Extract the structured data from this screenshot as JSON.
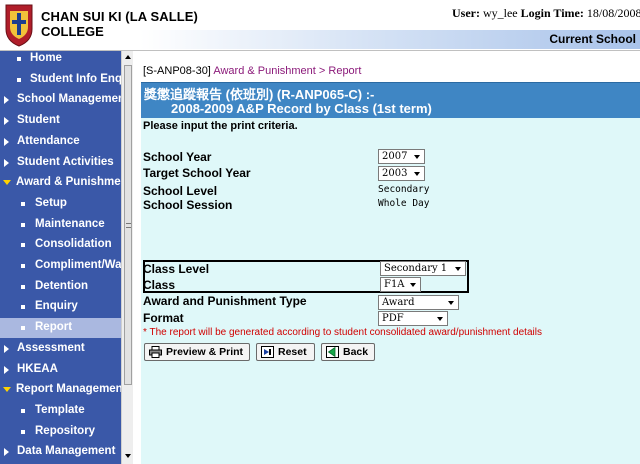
{
  "header": {
    "school_line1": "CHAN SUI KI (LA SALLE)",
    "school_line2": "COLLEGE",
    "user_label": "User:",
    "user_value": "wy_lee",
    "login_time_label": "Login Time:",
    "login_time_value": "18/08/2008",
    "current_school": "Current School"
  },
  "sidebar": {
    "items": [
      {
        "label": "Home",
        "type": "bullet"
      },
      {
        "label": "Student Info Enquiry",
        "type": "bullet"
      },
      {
        "label": "School Management",
        "type": "arrow"
      },
      {
        "label": "Student",
        "type": "arrow"
      },
      {
        "label": "Attendance",
        "type": "arrow"
      },
      {
        "label": "Student Activities",
        "type": "arrow"
      },
      {
        "label": "Award & Punishment",
        "type": "open"
      },
      {
        "label": "Setup",
        "type": "sub"
      },
      {
        "label": "Maintenance",
        "type": "sub"
      },
      {
        "label": "Consolidation",
        "type": "sub"
      },
      {
        "label": "Compliment/Warning",
        "type": "sub"
      },
      {
        "label": "Detention",
        "type": "sub"
      },
      {
        "label": "Enquiry",
        "type": "sub"
      },
      {
        "label": "Report",
        "type": "sub",
        "active": true
      },
      {
        "label": "Assessment",
        "type": "arrow"
      },
      {
        "label": "HKEAA",
        "type": "arrow"
      },
      {
        "label": "Report Management",
        "type": "open"
      },
      {
        "label": "Template",
        "type": "sub"
      },
      {
        "label": "Repository",
        "type": "sub"
      },
      {
        "label": "Data Management",
        "type": "arrow"
      }
    ]
  },
  "main": {
    "breadcrumb_code": "[S-ANP08-30]",
    "breadcrumb_path": "Award & Punishment > Report",
    "title_line1": "獎懲追蹤報告 (依班別) (R-ANP065-C) :-",
    "title_line2": "2008-2009 A&P Record by Class (1st term)",
    "instruction": "Please input the print criteria.",
    "form": {
      "school_year_label": "School Year",
      "school_year_value": "2007",
      "target_school_year_label": "Target School Year",
      "target_school_year_value": "2003",
      "school_level_label": "School Level",
      "school_level_value": "Secondary",
      "school_session_label": "School Session",
      "school_session_value": "Whole Day",
      "class_level_label": "Class Level",
      "class_level_value": "Secondary 1",
      "class_label": "Class",
      "class_value": "F1A",
      "award_type_label": "Award and Punishment Type",
      "award_type_value": "Award",
      "format_label": "Format",
      "format_value": "PDF"
    },
    "note": "* The report will be generated according to student consolidated award/punishment details",
    "buttons": {
      "preview_print": "Preview & Print",
      "reset": "Reset",
      "back": "Back"
    }
  },
  "colors": {
    "sidebar_bg": "#3a58a8",
    "title_bar": "#3f86c4",
    "content_bg": "#dff8f9",
    "breadcrumb_path": "#8b1a7a",
    "note_text": "#d00000"
  }
}
